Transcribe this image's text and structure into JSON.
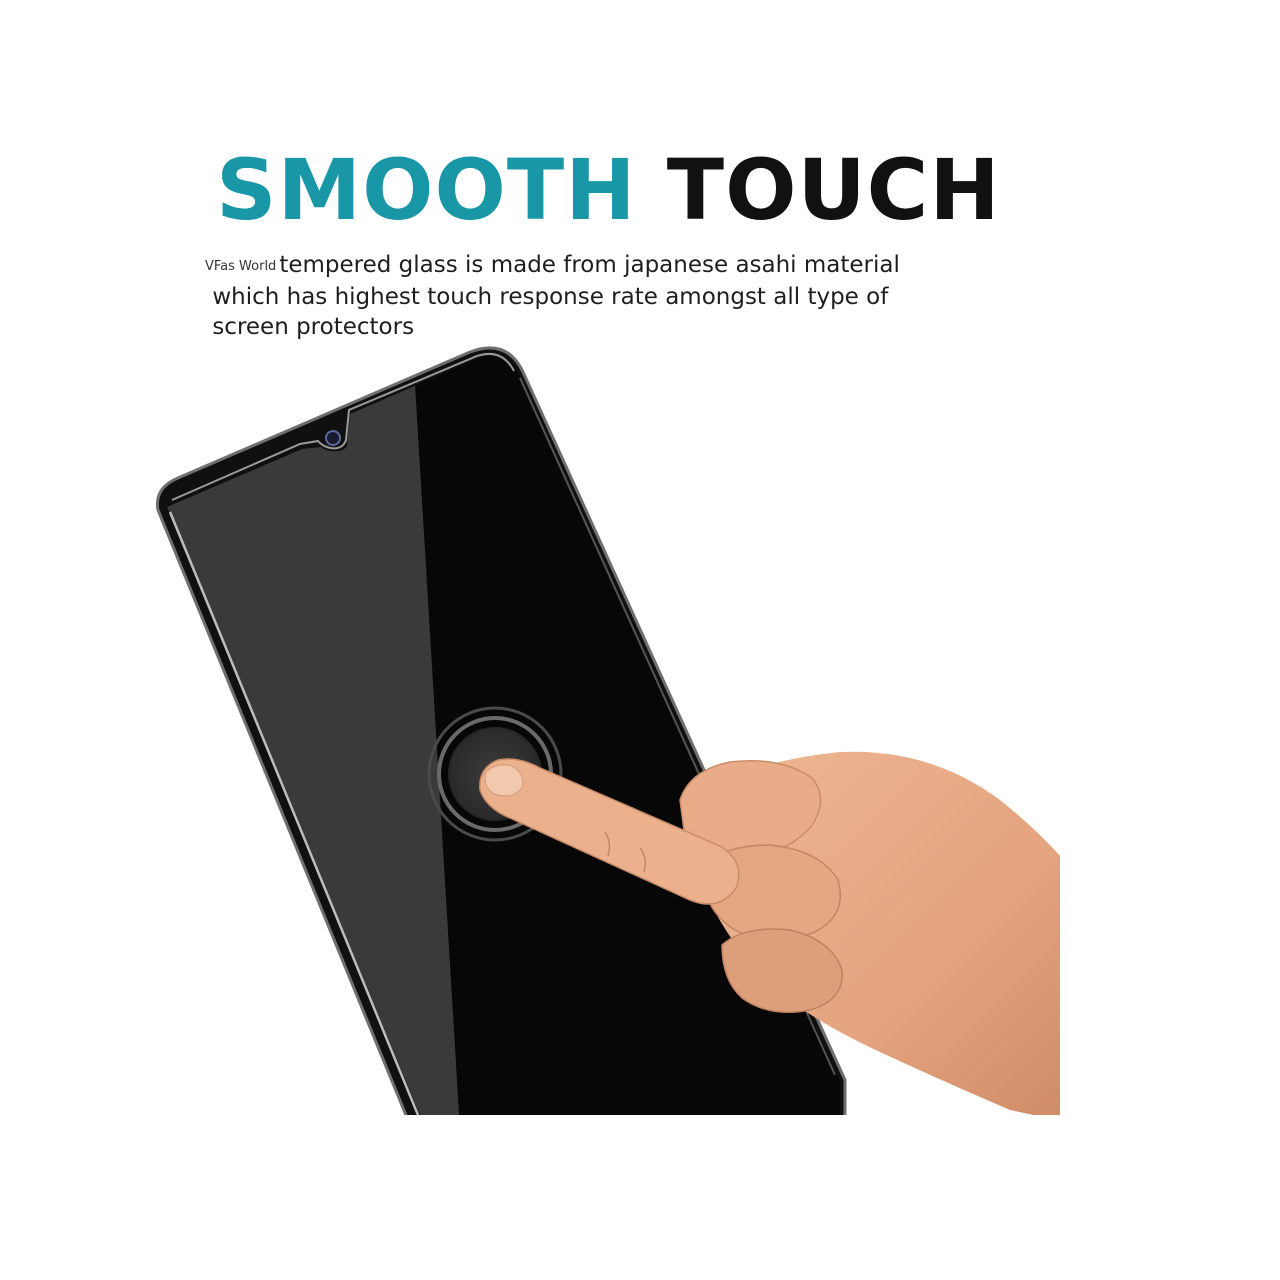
{
  "headline": {
    "word1": "SMOOTH",
    "word2": "TOUCH"
  },
  "description": {
    "brand": "VFas World",
    "line1": "tempered glass is made from japanese asahi material",
    "line2": "which has highest touch response rate amongst all type of",
    "line3": "screen protectors"
  },
  "colors": {
    "accent": "#1a97a6",
    "text": "#111111",
    "screen": "#0a0a0a",
    "skin": "#e6aa86"
  }
}
